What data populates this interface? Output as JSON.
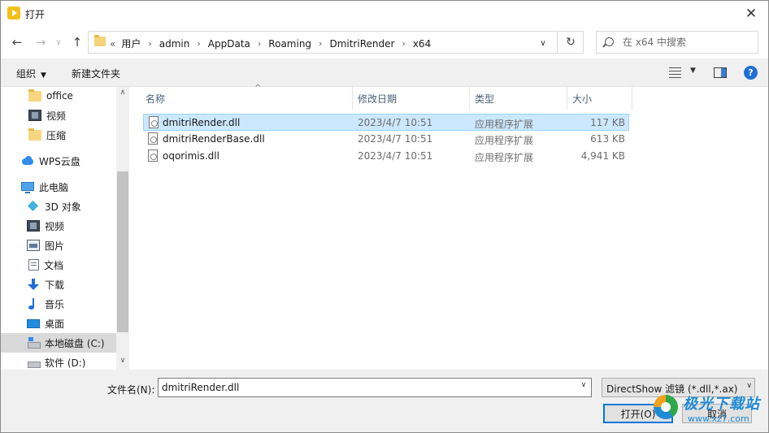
{
  "window": {
    "title": "打开",
    "close_glyph": "✕"
  },
  "nav": {
    "back": "←",
    "forward": "→",
    "dropdown": "∨",
    "up": "↑",
    "refresh": "↻"
  },
  "address": {
    "prefix": "«",
    "crumbs": [
      "用户",
      "admin",
      "AppData",
      "Roaming",
      "DmitriRender",
      "x64"
    ],
    "separator": "›"
  },
  "search": {
    "placeholder": "在 x64 中搜索"
  },
  "toolbar": {
    "organize": "组织",
    "new_folder": "新建文件夹",
    "help": "?"
  },
  "sidebar": {
    "items": [
      {
        "label": "office",
        "icon": "folder-icon"
      },
      {
        "label": "视频",
        "icon": "video-icon"
      },
      {
        "label": "压缩",
        "icon": "folder-icon"
      },
      {
        "label": "WPS云盘",
        "icon": "cloud-icon"
      },
      {
        "label": "此电脑",
        "icon": "computer-icon"
      },
      {
        "label": "3D 对象",
        "icon": "3d-objects-icon"
      },
      {
        "label": "视频",
        "icon": "video-icon"
      },
      {
        "label": "图片",
        "icon": "pictures-icon"
      },
      {
        "label": "文档",
        "icon": "documents-icon"
      },
      {
        "label": "下载",
        "icon": "download-icon"
      },
      {
        "label": "音乐",
        "icon": "music-icon"
      },
      {
        "label": "桌面",
        "icon": "desktop-icon"
      },
      {
        "label": "本地磁盘 (C:)",
        "icon": "local-disk-icon"
      },
      {
        "label": "软件 (D:)",
        "icon": "drive-icon"
      }
    ]
  },
  "files": {
    "columns": [
      "名称",
      "修改日期",
      "类型",
      "大小"
    ],
    "rows": [
      {
        "name": "dmitriRender.dll",
        "modified": "2023/4/7 10:51",
        "type": "应用程序扩展",
        "size": "117 KB"
      },
      {
        "name": "dmitriRenderBase.dll",
        "modified": "2023/4/7 10:51",
        "type": "应用程序扩展",
        "size": "613 KB"
      },
      {
        "name": "oqorimis.dll",
        "modified": "2023/4/7 10:51",
        "type": "应用程序扩展",
        "size": "4,941 KB"
      }
    ]
  },
  "bottom": {
    "filename_label": "文件名(N):",
    "filename_value": "dmitriRender.dll",
    "filter": "DirectShow 滤镜 (*.dll,*.ax)",
    "open_label": "打开(O)",
    "cancel_label": "取消"
  },
  "watermark": {
    "text": "极光下载站",
    "url": "www.xz7.com"
  },
  "colors": {
    "selection": "#cce8ff",
    "selection_border": "#99d1ff",
    "accent": "#0078d7",
    "header_text": "#4c607a"
  }
}
